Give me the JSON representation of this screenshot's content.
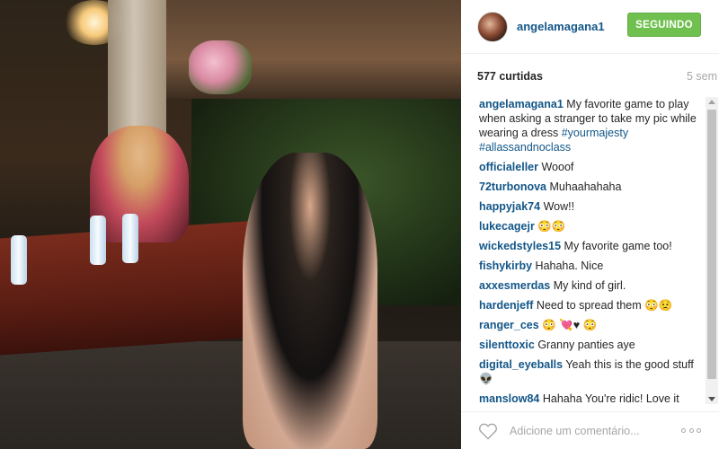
{
  "post": {
    "username": "angelamagana1",
    "follow_button_label": "SEGUINDO",
    "likes": "577 curtidas",
    "time_ago": "5 sem"
  },
  "caption": {
    "user": "angelamagana1",
    "text": "My favorite game to play when asking a stranger to take my pic while wearing a dress",
    "hashtags": "#yourmajesty #allassandnoclass"
  },
  "comments": [
    {
      "user": "officialeller",
      "text": "Wooof"
    },
    {
      "user": "72turbonova",
      "text": "Muhaahahaha"
    },
    {
      "user": "happyjak74",
      "text": "Wow!!"
    },
    {
      "user": "lukecagejr",
      "text": "😳😳"
    },
    {
      "user": "wickedstyles15",
      "text": "My favorite game too!"
    },
    {
      "user": "fishykirby",
      "text": "Hahaha. Nice"
    },
    {
      "user": "axxesmerdas",
      "text": "My kind of girl."
    },
    {
      "user": "hardenjeff",
      "text": "Need to spread them 😳😟"
    },
    {
      "user": "ranger_ces",
      "text": "😳 💘♥ 😳"
    },
    {
      "user": "silenttoxic",
      "text": "Granny panties aye"
    },
    {
      "user": "digital_eyeballs",
      "text": "Yeah this is the good stuff 👽"
    },
    {
      "user": "manslow84",
      "text": "Hahaha You're ridic! Love it"
    }
  ],
  "comment_input": {
    "placeholder": "Adicione um comentário..."
  },
  "icons": {
    "like": "heart-icon",
    "options": "more-options-icon"
  },
  "colors": {
    "username_blue": "#125688",
    "follow_green": "#70c050",
    "muted_gray": "#a5a7aa"
  }
}
